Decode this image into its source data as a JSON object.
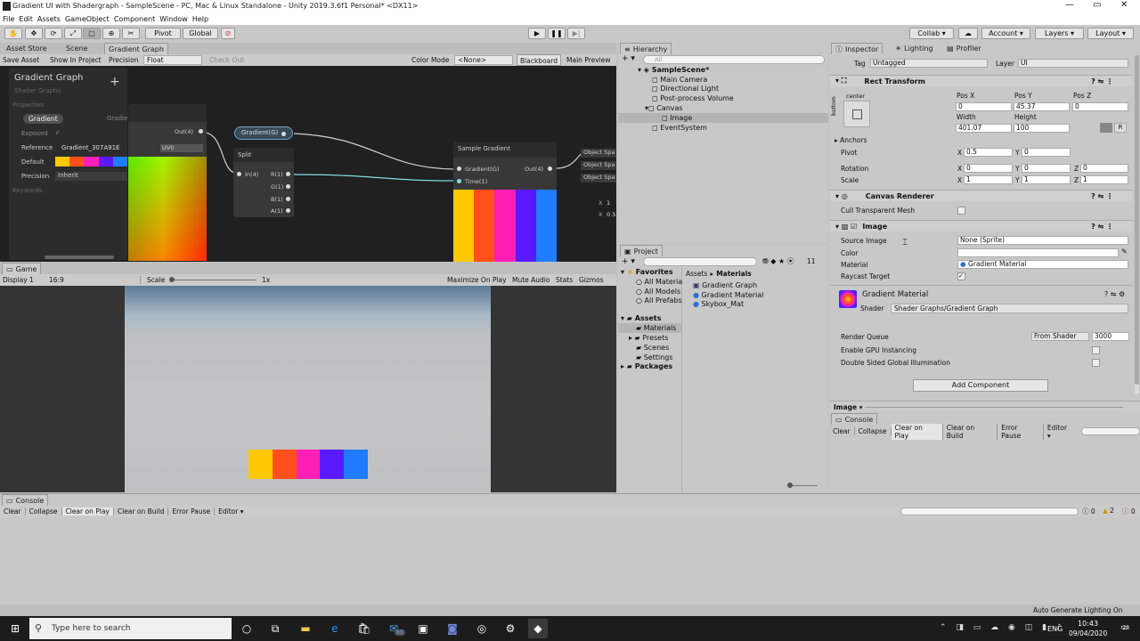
{
  "titlebar": {
    "title": "Gradient UI with Shadergraph - SampleScene - PC, Mac & Linux Standalone - Unity 2019.3.6f1 Personal* <DX11>"
  },
  "menu": [
    "File",
    "Edit",
    "Assets",
    "GameObject",
    "Component",
    "Window",
    "Help"
  ],
  "toolbar": {
    "pivot": "Pivot",
    "global": "Global",
    "collab": "Collab ▾",
    "account": "Account ▾",
    "layers": "Layers ▾",
    "layout": "Layout ▾"
  },
  "scene_tabs": [
    "Asset Store",
    "Scene",
    "Gradient Graph"
  ],
  "graph_toolbar": {
    "save": "Save Asset",
    "show": "Show In Project",
    "precision_label": "Precision",
    "precision_value": "Float",
    "checkout": "Check Out",
    "color_mode_label": "Color Mode",
    "color_mode_value": "<None>",
    "blackboard": "Blackboard",
    "main_preview": "Main Preview"
  },
  "blackboard": {
    "title": "Gradient Graph",
    "subtitle": "Shader Graphs",
    "properties": "Properties",
    "prop_name": "Gradient",
    "prop_type": "Gradie",
    "exposed": "Exposed",
    "reference_label": "Reference",
    "reference_value": "Gradient_307A91E",
    "default_label": "Default",
    "precision_label": "Precision",
    "precision_value": "Inherit",
    "keywords": "Keywords",
    "gradient_colors": [
      "#ffc800",
      "#ff4f1a",
      "#ff1fb4",
      "#5a1aff",
      "#1f7bff"
    ]
  },
  "nodes": {
    "out4": "Out(4)",
    "uv0": "UV0",
    "gradient_prop": "Gradient(G)",
    "split": "Split",
    "split_in": "In(4)",
    "split_r": "R(1)",
    "split_g": "G(1)",
    "split_b": "B(1)",
    "split_a": "A(1)",
    "sample": "Sample Gradient",
    "sample_grad": "Gradient(G)",
    "sample_time": "Time(1)",
    "sample_out": "Out(4)",
    "obj1": "Object Spa",
    "obj2": "Object Spa",
    "obj3": "Object Spa",
    "x_label": "X",
    "x1": "1",
    "x2": "0.5"
  },
  "game": {
    "tab": "Game",
    "display": "Display 1",
    "aspect": "16:9",
    "scale_label": "Scale",
    "scale_value": "1x",
    "maximize": "Maximize On Play",
    "mute": "Mute Audio",
    "stats": "Stats",
    "gizmos": "Gizmos"
  },
  "hierarchy": {
    "tab": "Hierarchy",
    "search": "All",
    "scene": "SampleScene*",
    "items": [
      "Main Camera",
      "Directional Light",
      "Post-process Volume",
      "Canvas",
      "Image",
      "EventSystem"
    ]
  },
  "project": {
    "tab": "Project",
    "favorites": "Favorites",
    "fav_items": [
      "All Materia",
      "All Models",
      "All Prefabs"
    ],
    "assets": "Assets",
    "asset_folders": [
      "Materials",
      "Presets",
      "Scenes",
      "Settings"
    ],
    "packages": "Packages",
    "breadcrumb_assets": "Assets",
    "breadcrumb_materials": "Materials",
    "files": [
      "Gradient Graph",
      "Gradient Material",
      "Skybox_Mat"
    ],
    "count": "11"
  },
  "inspector": {
    "tab": "Inspector",
    "lighting": "Lighting",
    "profiler": "Profiler",
    "tag_label": "Tag",
    "tag_value": "Untagged",
    "layer_label": "Layer",
    "layer_value": "UI",
    "rect": {
      "title": "Rect Transform",
      "center": "center",
      "bottom": "bottom",
      "posx_label": "Pos X",
      "posy_label": "Pos Y",
      "posz_label": "Pos Z",
      "posx": "0",
      "posy": "45.37",
      "posz": "0",
      "width_label": "Width",
      "height_label": "Height",
      "width": "401.07",
      "height": "100",
      "anchors": "Anchors",
      "pivot": "Pivot",
      "pivot_x": "0.5",
      "pivot_y": "0",
      "rotation": "Rotation",
      "rot_x": "0",
      "rot_y": "0",
      "rot_z": "0",
      "scale": "Scale",
      "scale_x": "1",
      "scale_y": "1",
      "scale_z": "1",
      "x": "X",
      "y": "Y",
      "z": "Z",
      "r": "R"
    },
    "canvas_renderer": {
      "title": "Canvas Renderer",
      "cull": "Cull Transparent Mesh"
    },
    "image": {
      "title": "Image",
      "source_label": "Source Image",
      "source_value": "None (Sprite)",
      "color_label": "Color",
      "material_label": "Material",
      "material_value": "Gradient Material",
      "raycast_label": "Raycast Target"
    },
    "material": {
      "title": "Gradient Material",
      "shader_label": "Shader",
      "shader_value": "Shader Graphs/Gradient Graph",
      "render_queue_label": "Render Queue",
      "render_queue_mode": "From Shader",
      "render_queue_value": "3000",
      "gpu_instancing": "Enable GPU Instancing",
      "double_sided": "Double Sided Global Illumination"
    },
    "add_component": "Add Component",
    "footer": "Image ▾"
  },
  "console_small": {
    "tab": "Console",
    "clear": "Clear",
    "collapse": "Collapse",
    "clear_play": "Clear on Play",
    "clear_build": "Clear on Build",
    "error_pause": "Error Pause",
    "editor": "Editor ▾"
  },
  "console_big": {
    "tab": "Console",
    "clear": "Clear",
    "collapse": "Collapse",
    "clear_play": "Clear on Play",
    "clear_build": "Clear on Build",
    "error_pause": "Error Pause",
    "editor": "Editor ▾",
    "count_info": "0",
    "count_warn": "2",
    "count_err": "0"
  },
  "statusbar": {
    "text": "Auto Generate Lighting On"
  },
  "taskbar": {
    "search": "Type here to search",
    "mail_badge": "65",
    "lang": "ENG",
    "time": "10:43",
    "date": "09/04/2020",
    "notif": "23"
  }
}
